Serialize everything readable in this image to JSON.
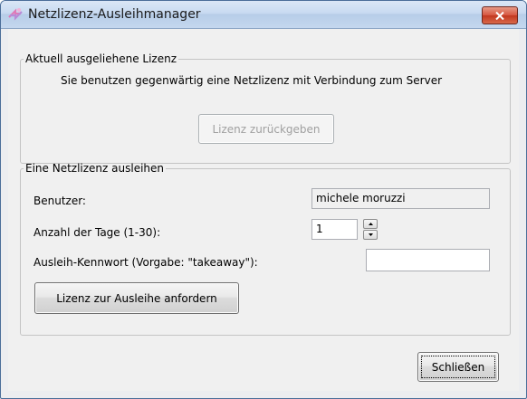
{
  "window": {
    "title": "Netzlizenz-Ausleihmanager"
  },
  "current": {
    "legend": "Aktuell ausgeliehene Lizenz",
    "info": "Sie benutzen gegenwärtig eine Netzlizenz mit Verbindung zum Server",
    "return_button": "Lizenz zurückgeben"
  },
  "borrow": {
    "legend": "Eine Netzlizenz ausleihen",
    "user_label": "Benutzer:",
    "user_value": "michele moruzzi",
    "days_label": "Anzahl der Tage (1-30):",
    "days_value": "1",
    "password_label": "Ausleih-Kennwort (Vorgabe: \"takeaway\"):",
    "password_value": "",
    "request_button": "Lizenz zur Ausleihe anfordern"
  },
  "footer": {
    "close_button": "Schließen"
  },
  "colors": {
    "close_red": "#c2371f",
    "titlebar": "#c8daf1"
  }
}
